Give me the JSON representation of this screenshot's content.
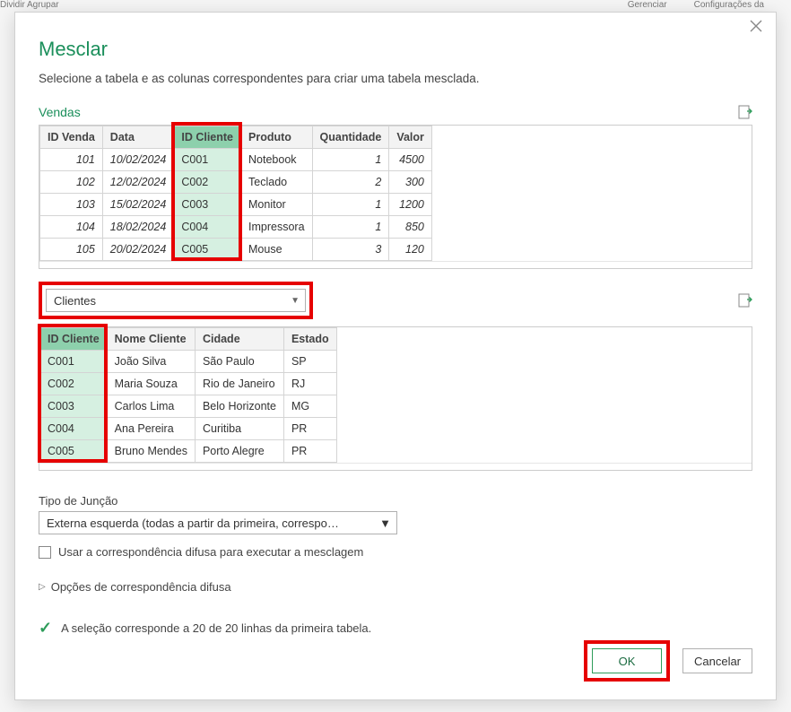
{
  "bg": {
    "a": "Dividir   Agrupar",
    "b": "Gerenciar",
    "c": "Configurações da"
  },
  "dialog": {
    "title": "Mesclar",
    "subtitle": "Selecione a tabela e as colunas correspondentes para criar uma tabela mesclada.",
    "table1_label": "Vendas",
    "table1": {
      "headers": [
        "ID Venda",
        "Data",
        "ID Cliente",
        "Produto",
        "Quantidade",
        "Valor"
      ],
      "join_col_index": 2,
      "rows": [
        [
          "101",
          "10/02/2024",
          "C001",
          "Notebook",
          "1",
          "4500"
        ],
        [
          "102",
          "12/02/2024",
          "C002",
          "Teclado",
          "2",
          "300"
        ],
        [
          "103",
          "15/02/2024",
          "C003",
          "Monitor",
          "1",
          "1200"
        ],
        [
          "104",
          "18/02/2024",
          "C004",
          "Impressora",
          "1",
          "850"
        ],
        [
          "105",
          "20/02/2024",
          "C005",
          "Mouse",
          "3",
          "120"
        ]
      ],
      "numeric_cols": [
        0,
        1,
        4,
        5
      ]
    },
    "second_table_dd": "Clientes",
    "table2": {
      "headers": [
        "ID Cliente",
        "Nome Cliente",
        "Cidade",
        "Estado"
      ],
      "join_col_index": 0,
      "rows": [
        [
          "C001",
          "João Silva",
          "São Paulo",
          "SP"
        ],
        [
          "C002",
          "Maria Souza",
          "Rio de Janeiro",
          "RJ"
        ],
        [
          "C003",
          "Carlos Lima",
          "Belo Horizonte",
          "MG"
        ],
        [
          "C004",
          "Ana Pereira",
          "Curitiba",
          "PR"
        ],
        [
          "C005",
          "Bruno Mendes",
          "Porto Alegre",
          "PR"
        ]
      ]
    },
    "join_label": "Tipo de Junção",
    "join_value": "Externa esquerda (todas a partir da primeira, correspo…",
    "fuzzy_checkbox": "Usar a correspondência difusa para executar a mesclagem",
    "fuzzy_expander": "Opções de correspondência difusa",
    "status": "A seleção corresponde a 20 de 20 linhas da primeira tabela.",
    "ok": "OK",
    "cancel": "Cancelar"
  }
}
